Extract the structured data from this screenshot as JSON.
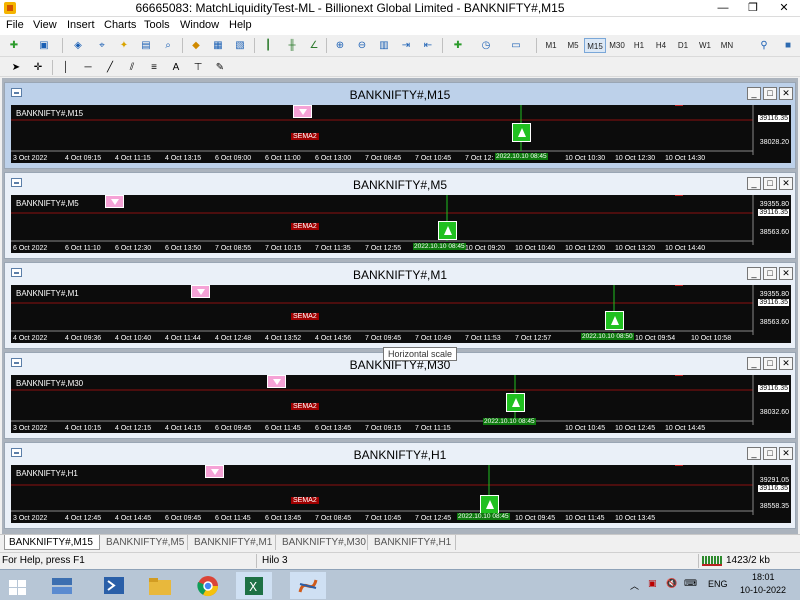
{
  "window": {
    "title": "66665083: MatchLiquidityTest-ML - Billionext Global Limited - BANKNIFTY#,M15",
    "min": "—",
    "max": "❐",
    "close": "✕"
  },
  "menu": [
    "File",
    "View",
    "Insert",
    "Charts",
    "Tools",
    "Window",
    "Help"
  ],
  "timeframes": [
    "M1",
    "M5",
    "M15",
    "M30",
    "H1",
    "H4",
    "D1",
    "W1",
    "MN"
  ],
  "active_timeframe": "M15",
  "charts": [
    {
      "title": "BANKNIFTY#,M15",
      "symbol": "BANKNIFTY#,M15",
      "ema_label": "SEMA2",
      "prices": [
        "39116.35",
        "38028.20"
      ],
      "times": [
        "3 Oct 2022",
        "4 Oct 09:15",
        "4 Oct 11:15",
        "4 Oct 13:15",
        "6 Oct 09:00",
        "6 Oct 11:00",
        "6 Oct 13:00",
        "7 Oct 08:45",
        "7 Oct 10:45",
        "7 Oct 12:",
        "10 Oct 08:45",
        "10 Oct 10:30",
        "10 Oct 12:30",
        "10 Oct 14:30"
      ],
      "signal_date": "2022.10.10 08:45"
    },
    {
      "title": "BANKNIFTY#,M5",
      "symbol": "BANKNIFTY#,M5",
      "ema_label": "SEMA2",
      "prices": [
        "39355.80",
        "39116.35",
        "38563.60"
      ],
      "times": [
        "6 Oct 2022",
        "6 Oct 11:10",
        "6 Oct 12:30",
        "6 Oct 13:50",
        "7 Oct 08:55",
        "7 Oct 10:15",
        "7 Oct 11:35",
        "7 Oct 12:55",
        "",
        "10 Oct 09:20",
        "10 Oct 10:40",
        "10 Oct 12:00",
        "10 Oct 13:20",
        "10 Oct 14:40"
      ],
      "signal_date": "2022.10.10 08:45"
    },
    {
      "title": "BANKNIFTY#,M1",
      "symbol": "BANKNIFTY#,M1",
      "ema_label": "SEMA2",
      "prices": [
        "39355.80",
        "39116.35",
        "38563.60"
      ],
      "times": [
        "4 Oct 2022",
        "4 Oct 09:36",
        "4 Oct 10:40",
        "4 Oct 11:44",
        "4 Oct 12:48",
        "4 Oct 13:52",
        "4 Oct 14:56",
        "7 Oct 09:45",
        "7 Oct 10:49",
        "7 Oct 11:53",
        "7 Oct 12:57",
        "",
        "10 Oct 09:54",
        "10 Oct 10:58"
      ],
      "signal_date": "2022.10.10 08:50"
    },
    {
      "title": "BANKNIFTY#,M30",
      "symbol": "BANKNIFTY#,M30",
      "ema_label": "SEMA2",
      "prices": [
        "39116.35",
        "38032.60"
      ],
      "times": [
        "3 Oct 2022",
        "4 Oct 10:15",
        "4 Oct 12:15",
        "4 Oct 14:15",
        "6 Oct 09:45",
        "6 Oct 11:45",
        "6 Oct 13:45",
        "7 Oct 09:15",
        "7 Oct 11:15",
        "",
        "10 Oct 10:45",
        "10 Oct 12:45",
        "10 Oct 14:45"
      ],
      "signal_date": "2022.10.10 08:45"
    },
    {
      "title": "BANKNIFTY#,H1",
      "symbol": "BANKNIFTY#,H1",
      "ema_label": "SEMA2",
      "prices": [
        "39291.05",
        "39116.35",
        "38558.35"
      ],
      "times": [
        "3 Oct 2022",
        "4 Oct 12:45",
        "4 Oct 14:45",
        "6 Oct 09:45",
        "6 Oct 11:45",
        "6 Oct 13:45",
        "7 Oct 08:45",
        "7 Oct 10:45",
        "7 Oct 12:45",
        "",
        "10 Oct 09:45",
        "10 Oct 11:45",
        "10 Oct 13:45"
      ],
      "signal_date": "2022.10.10 08:45"
    }
  ],
  "tooltip": "Horizontal scale",
  "tabs": [
    "BANKNIFTY#,M15",
    "BANKNIFTY#,M5",
    "BANKNIFTY#,M1",
    "BANKNIFTY#,M30",
    "BANKNIFTY#,H1"
  ],
  "status": {
    "help": "For Help, press F1",
    "profile": "Hilo 3",
    "traffic": "1423/2 kb"
  },
  "taskbar": {
    "lang": "ENG",
    "time": "18:01",
    "date": "10-10-2022"
  },
  "colors": {
    "chart_bg": "#0c0c0c",
    "grid_red": "#8b1010",
    "buy_green": "#20c020",
    "sell_pink": "#f5a2d6"
  }
}
